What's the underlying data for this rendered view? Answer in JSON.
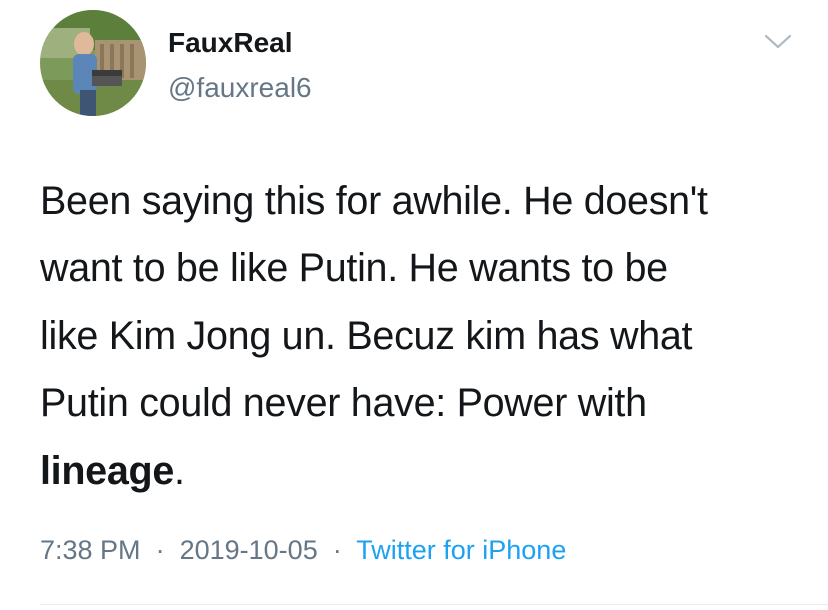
{
  "author": {
    "display_name": "FauxReal",
    "handle": "@fauxreal6"
  },
  "tweet": {
    "lines": [
      "Been saying this for awhile. He doesn't",
      "want to be like Putin. He wants to be",
      "like Kim Jong un. Becuz kim has what",
      "Putin could never have: Power with"
    ],
    "last_line_bold": "lineage",
    "last_line_tail": ".",
    "time": "7:38 PM",
    "separator": "·",
    "date": "2019-10-05",
    "source": "Twitter for iPhone"
  },
  "icons": {
    "avatar": "profile-photo",
    "caret": "chevron-down-icon"
  },
  "colors": {
    "text": "#14171a",
    "secondary": "#657786",
    "link": "#1da1f2",
    "divider": "#e6ecf0"
  }
}
